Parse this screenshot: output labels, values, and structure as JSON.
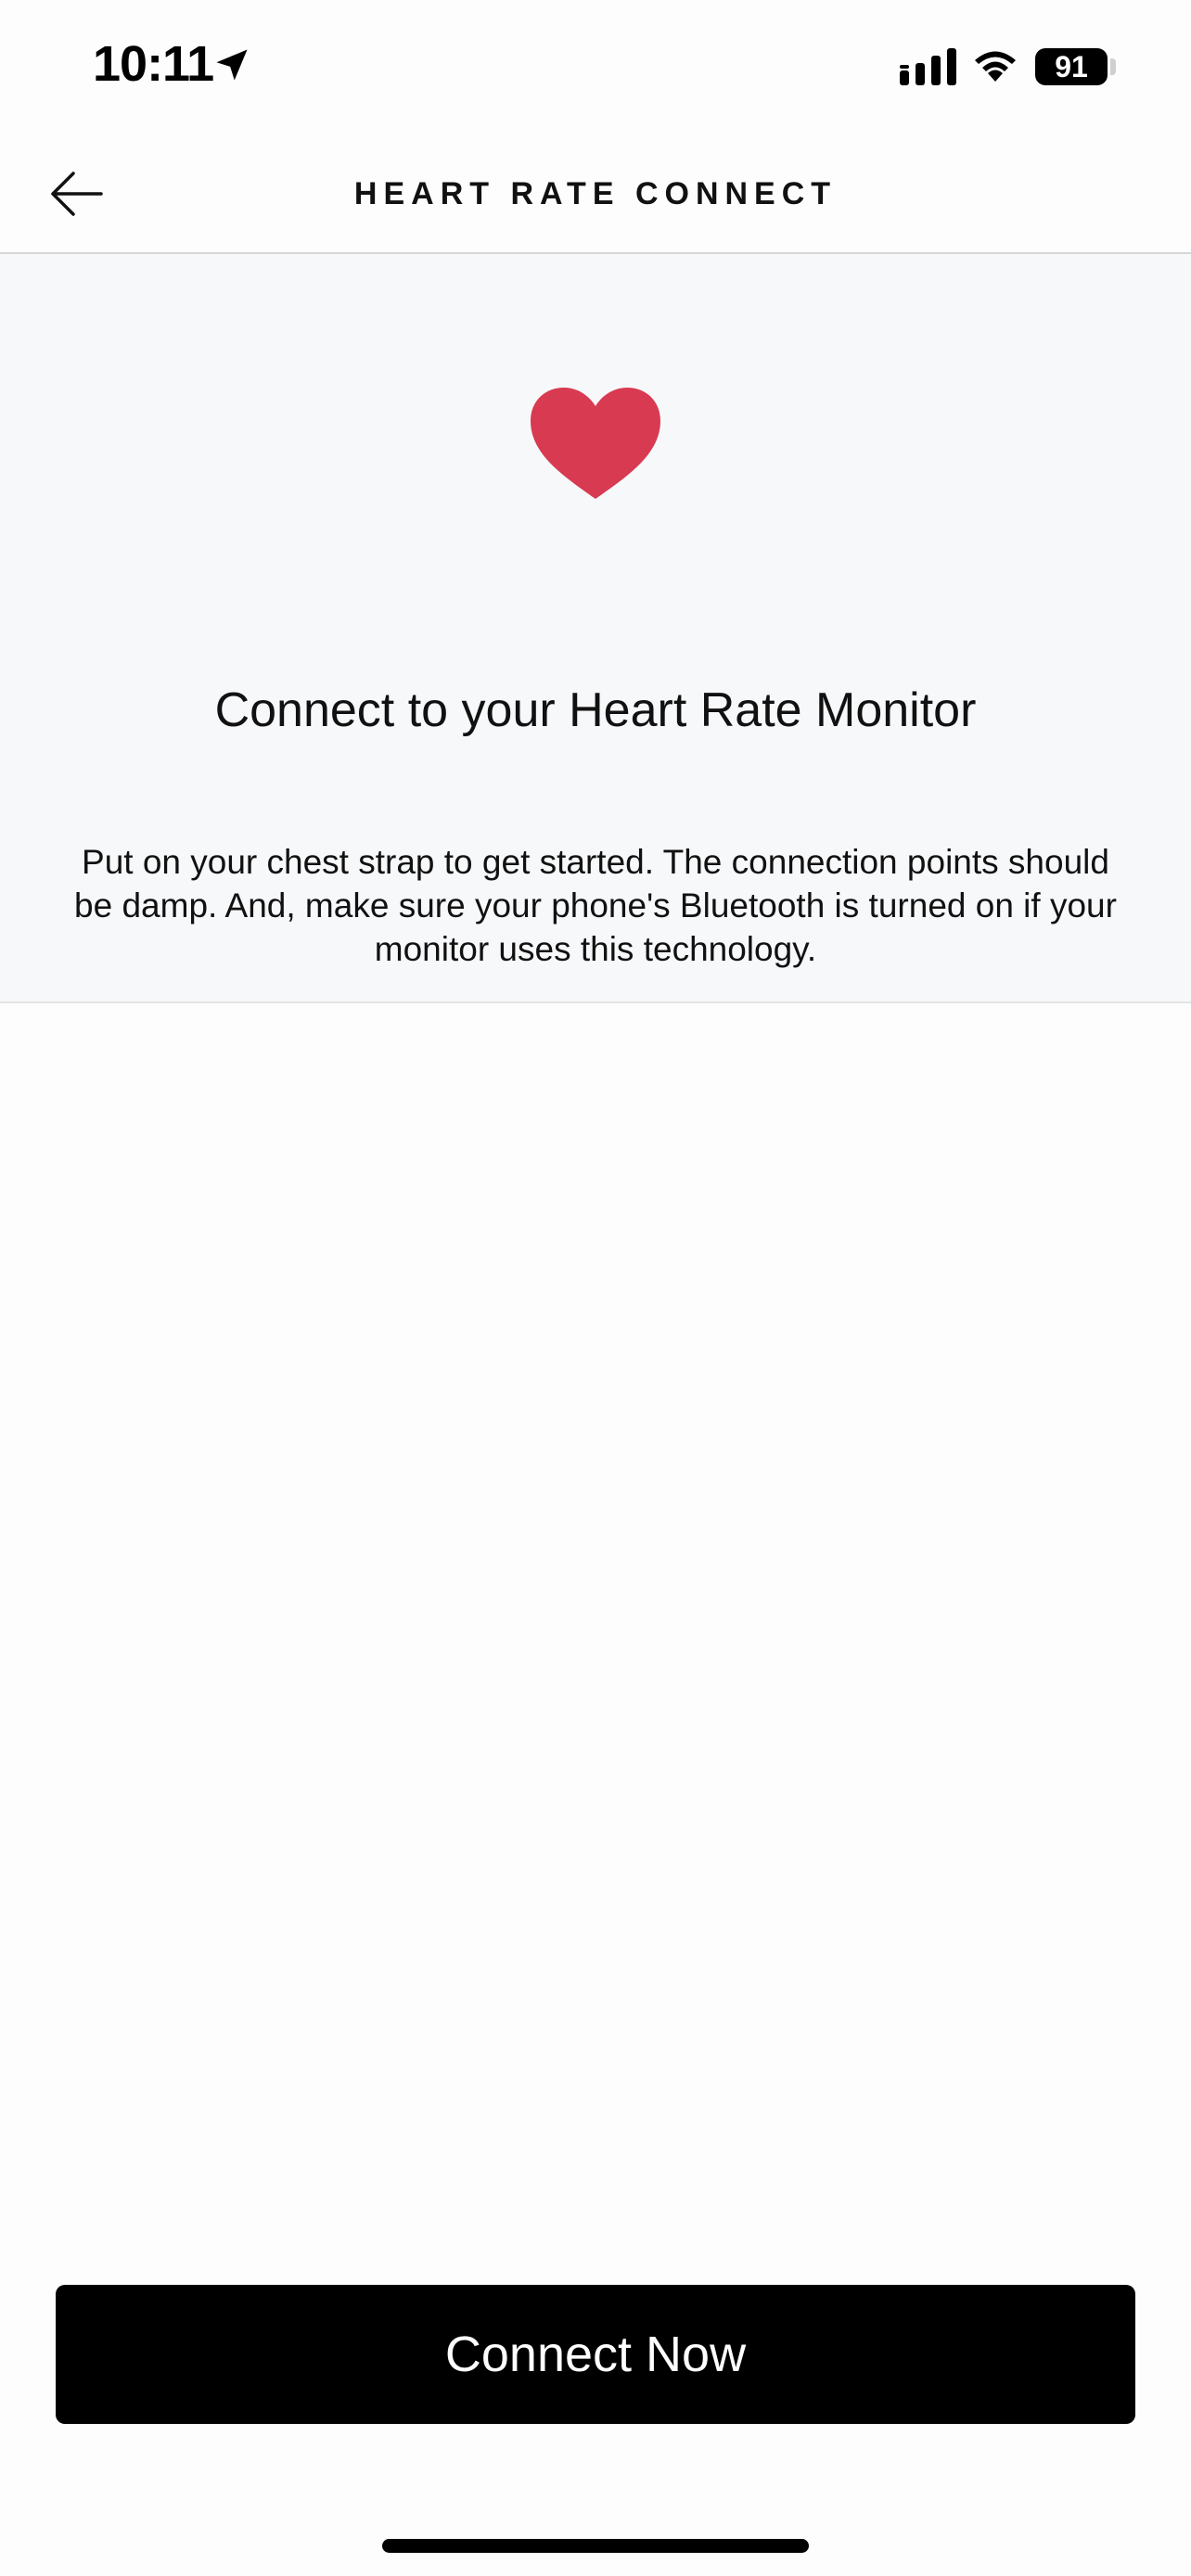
{
  "status_bar": {
    "time": "10:11",
    "battery": "91",
    "icons": [
      "location-arrow-icon",
      "cellular-signal-icon",
      "wifi-icon",
      "battery-icon"
    ]
  },
  "header": {
    "title": "HEART RATE CONNECT",
    "back_icon": "arrow-left-icon"
  },
  "info": {
    "icon": "heart-icon",
    "title": "Connect to your Heart Rate Monitor",
    "description": "Put on your chest strap to get started. The connection points should be damp. And, make sure your phone's Bluetooth is turned on if your monitor uses this technology."
  },
  "actions": {
    "connect_label": "Connect Now"
  },
  "colors": {
    "heart": "#d83a52",
    "button_bg": "#000000",
    "section_bg": "#f7f8fa",
    "page_bg": "#fdfdfd"
  }
}
